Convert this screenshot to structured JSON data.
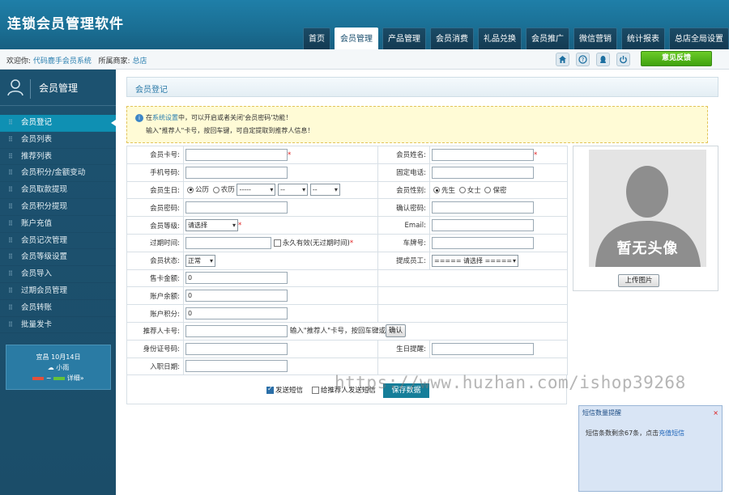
{
  "app": {
    "title": "连锁会员管理软件"
  },
  "nav": {
    "items": [
      "首页",
      "会员管理",
      "产品管理",
      "会员消费",
      "礼品兑换",
      "会员推广",
      "微信营销",
      "统计报表",
      "总店全局设置"
    ],
    "active_index": 1
  },
  "infobar": {
    "welcome_label": "欢迎你:",
    "user": "代码鹿手会员系统",
    "merchant_label": "所属商家:",
    "merchant": "总店",
    "feedback_button": "意见反馈"
  },
  "sidebar": {
    "title": "会员管理",
    "items": [
      "会员登记",
      "会员列表",
      "推荐列表",
      "会员积分/金额变动",
      "会员取款提现",
      "会员积分提现",
      "账户充值",
      "会员记次管理",
      "会员等级设置",
      "会员导入",
      "过期会员管理",
      "会员转账",
      "批量发卡"
    ],
    "active_index": 0,
    "weather": {
      "line1": "宜昌 10月14日",
      "line2": "小雨",
      "line3": "~",
      "detail": "详细»"
    }
  },
  "section": {
    "title": "会员登记"
  },
  "notice": {
    "line1_pre": "在",
    "line1_link": "系统设置",
    "line1_post": "中，可以开启或者关闭'会员密码'功能！",
    "line2": "输入\"推荐人\"卡号，按回车键，可自定提取到推荐人信息！"
  },
  "form": {
    "card_no_label": "会员卡号:",
    "name_label": "会员姓名:",
    "phone_label": "手机号码:",
    "tel_label": "固定电话:",
    "birthday_label": "会员生日:",
    "solar_label": "公历",
    "lunar_label": "农历",
    "year_option": "-----",
    "month_option": "--",
    "day_option": "--",
    "gender_label": "会员性别:",
    "male_label": "先生",
    "female_label": "女士",
    "secret_label": "保密",
    "password_label": "会员密码:",
    "confirm_label": "确认密码:",
    "level_label": "会员等级:",
    "level_value": "请选择",
    "email_label": "Email:",
    "expire_label": "过期时间:",
    "permanent_label": "永久有效(无过期时间)",
    "plate_label": "车牌号:",
    "status_label": "会员状态:",
    "status_value": "正常",
    "staff_label": "提成员工:",
    "staff_value": "===== 请选择 =====",
    "sale_label": "售卡金额:",
    "sale_value": "0",
    "balance_label": "账户余额:",
    "balance_value": "0",
    "points_label": "账户积分:",
    "points_value": "0",
    "referrer_label": "推荐人卡号:",
    "referrer_hint": "输入\"推荐人\"卡号，按回车键或",
    "confirm_button": "确认",
    "id_label": "身份证号码:",
    "bday_remind_label": "生日提醒:",
    "join_label": "入职日期:",
    "send_sms_label": "发送短信",
    "send_ref_sms_label": "给推荐人发送短信",
    "save_button": "保存数据"
  },
  "photo": {
    "placeholder": "暂无头像",
    "upload_button": "上传图片"
  },
  "sms": {
    "title": "短信数量提醒",
    "close": "×",
    "body_pre": "短信条数剩余67条，点击",
    "body_link": "充值短信"
  },
  "watermark": "https://www.huzhan.com/ishop39268"
}
